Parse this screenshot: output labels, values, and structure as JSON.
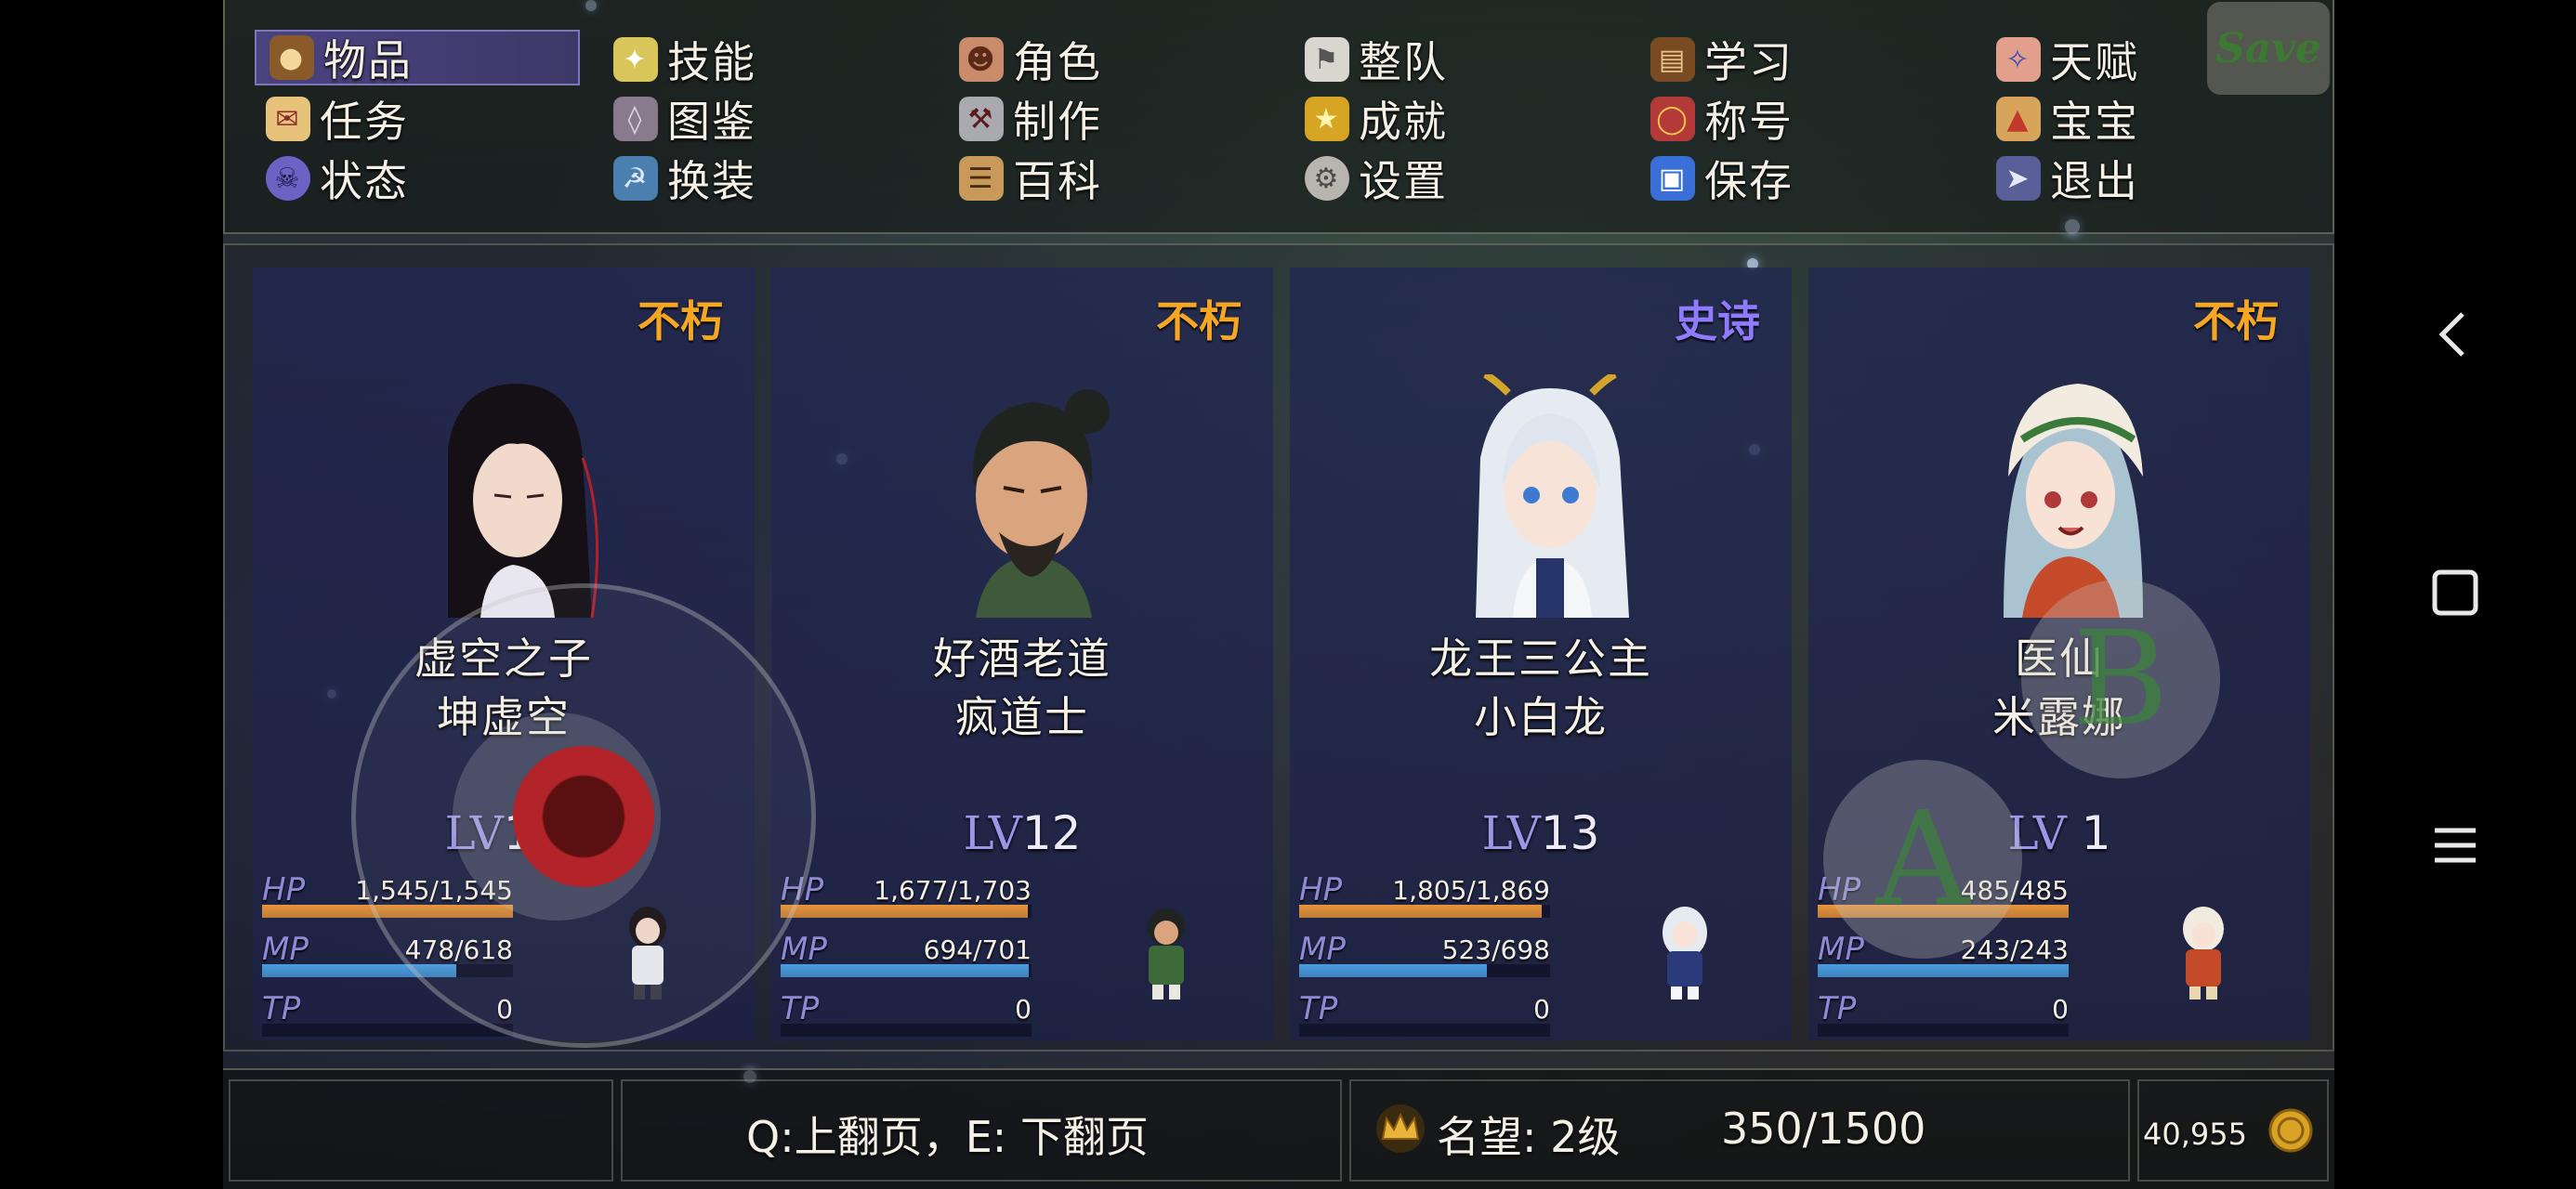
{
  "menu": {
    "items": [
      {
        "label": "物品",
        "icon": "bag-icon"
      },
      {
        "label": "技能",
        "icon": "skill-icon"
      },
      {
        "label": "角色",
        "icon": "masks-icon"
      },
      {
        "label": "整队",
        "icon": "flag-icon"
      },
      {
        "label": "学习",
        "icon": "book-icon"
      },
      {
        "label": "天赋",
        "icon": "talent-icon"
      },
      {
        "label": "任务",
        "icon": "scroll-icon"
      },
      {
        "label": "图鉴",
        "icon": "bestiary-icon"
      },
      {
        "label": "制作",
        "icon": "anvil-icon"
      },
      {
        "label": "成就",
        "icon": "trophy-icon"
      },
      {
        "label": "称号",
        "icon": "medal-icon"
      },
      {
        "label": "宝宝",
        "icon": "chicken-icon"
      },
      {
        "label": "状态",
        "icon": "skull-icon"
      },
      {
        "label": "换装",
        "icon": "outfit-icon"
      },
      {
        "label": "百科",
        "icon": "encyclopedia-icon"
      },
      {
        "label": "设置",
        "icon": "gear-icon"
      },
      {
        "label": "保存",
        "icon": "floppy-disk-icon"
      },
      {
        "label": "退出",
        "icon": "exit-icon"
      }
    ],
    "selected": "物品",
    "save_label": "Save"
  },
  "party": [
    {
      "rarity": "不朽",
      "rarity_color": "#f5a623",
      "title": "虚空之子",
      "name": "坤虚空",
      "level_word": "LV",
      "level": "10",
      "hp": "1,545/1,545",
      "mp": "478/618",
      "tp": "0",
      "hp_ratio": 1.0,
      "mp_ratio": 0.773,
      "tp_ratio": 0
    },
    {
      "rarity": "不朽",
      "rarity_color": "#f5a623",
      "title": "好酒老道",
      "name": "疯道士",
      "level_word": "LV",
      "level": "12",
      "hp": "1,677/1,703",
      "mp": "694/701",
      "tp": "0",
      "hp_ratio": 0.985,
      "mp_ratio": 0.99,
      "tp_ratio": 0
    },
    {
      "rarity": "史诗",
      "rarity_color": "#8e7bff",
      "title": "龙王三公主",
      "name": "小白龙",
      "level_word": "LV",
      "level": "13",
      "hp": "1,805/1,869",
      "mp": "523/698",
      "tp": "0",
      "hp_ratio": 0.966,
      "mp_ratio": 0.749,
      "tp_ratio": 0
    },
    {
      "rarity": "不朽",
      "rarity_color": "#f5a623",
      "title": "医仙",
      "name": "米露娜",
      "level_word": "LV",
      "level": "1",
      "hp": "485/485",
      "mp": "243/243",
      "tp": "0",
      "hp_ratio": 1.0,
      "mp_ratio": 1.0,
      "tp_ratio": 0
    }
  ],
  "stat_labels": {
    "hp": "HP",
    "mp": "MP",
    "tp": "TP"
  },
  "colors": {
    "hp": "#e8953a",
    "mp": "#4a9de0",
    "tp": "#3c5a9a",
    "panel": "#262c58"
  },
  "controls": {
    "a_label": "A",
    "b_label": "B"
  },
  "footer": {
    "page_hint": "Q:上翻页，E: 下翻页",
    "reputation_label": "名望: 2级",
    "reputation_progress": "350/1500",
    "gold": "40,955"
  },
  "android_nav": [
    "back-icon",
    "home-icon",
    "menu-icon"
  ]
}
